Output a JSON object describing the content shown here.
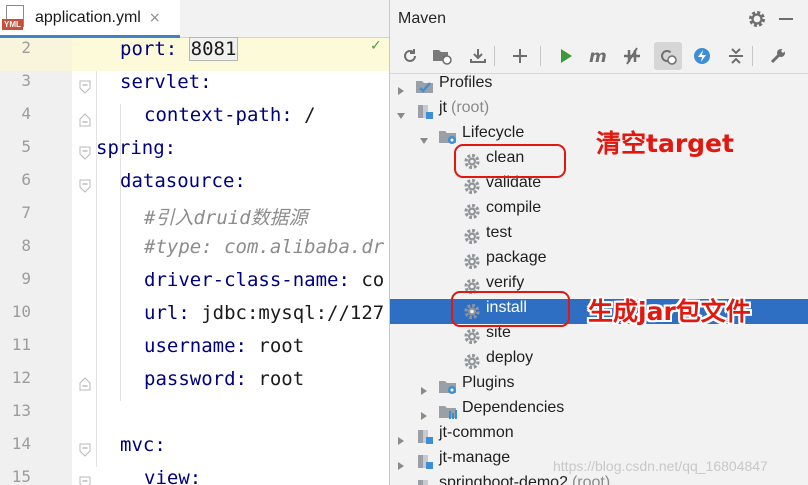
{
  "editor": {
    "tab_title": "application.yml",
    "tab_icon_label": "YML",
    "tab_close": "×",
    "lines": [
      {
        "num": "2",
        "key": "port",
        "sep": ": ",
        "val": "8081",
        "current": true
      },
      {
        "num": "3",
        "key": "servlet",
        "sep": ":",
        "val": ""
      },
      {
        "num": "4",
        "key": "context-path",
        "sep": ": ",
        "val": "/"
      },
      {
        "num": "5",
        "key": "spring",
        "sep": ":",
        "val": ""
      },
      {
        "num": "6",
        "key": "datasource",
        "sep": ":",
        "val": ""
      },
      {
        "num": "7",
        "comment": "#引入druid数据源"
      },
      {
        "num": "8",
        "comment": "#type: com.alibaba.dr"
      },
      {
        "num": "9",
        "key": "driver-class-name",
        "sep": ": ",
        "val": "co"
      },
      {
        "num": "10",
        "key": "url",
        "sep": ": ",
        "val": "jdbc:mysql://127"
      },
      {
        "num": "11",
        "key": "username",
        "sep": ": ",
        "val": "root"
      },
      {
        "num": "12",
        "key": "password",
        "sep": ": ",
        "val": "root"
      },
      {
        "num": "13"
      },
      {
        "num": "14",
        "key": "mvc",
        "sep": ":",
        "val": ""
      },
      {
        "num": "15",
        "key": "view",
        "sep": ":",
        "val": ""
      }
    ]
  },
  "maven": {
    "title": "Maven",
    "toolbar_icons": [
      "reload-icon",
      "generate-sources-icon",
      "download-icon",
      "add-icon",
      "run-icon",
      "execute-goal-icon",
      "toggle-offline-icon",
      "skip-tests-icon",
      "show-dependencies-icon",
      "collapse-all-icon",
      "settings-wrench-icon"
    ],
    "tree": [
      {
        "label": "Profiles",
        "muted": "",
        "icon": "profiles-icon",
        "arrow": "right",
        "level": 0
      },
      {
        "label": "jt",
        "muted": "(root)",
        "icon": "maven-module-icon",
        "arrow": "down",
        "level": 0
      },
      {
        "label": "Lifecycle",
        "muted": "",
        "icon": "lifecycle-folder-icon",
        "arrow": "down",
        "level": 1
      },
      {
        "label": "clean",
        "muted": "",
        "icon": "goal-gear-icon",
        "arrow": "",
        "level": 2
      },
      {
        "label": "validate",
        "muted": "",
        "icon": "goal-gear-icon",
        "arrow": "",
        "level": 2
      },
      {
        "label": "compile",
        "muted": "",
        "icon": "goal-gear-icon",
        "arrow": "",
        "level": 2
      },
      {
        "label": "test",
        "muted": "",
        "icon": "goal-gear-icon",
        "arrow": "",
        "level": 2
      },
      {
        "label": "package",
        "muted": "",
        "icon": "goal-gear-icon",
        "arrow": "",
        "level": 2
      },
      {
        "label": "verify",
        "muted": "",
        "icon": "goal-gear-icon",
        "arrow": "",
        "level": 2
      },
      {
        "label": "install",
        "muted": "",
        "icon": "goal-gear-icon",
        "arrow": "",
        "level": 2,
        "selected": true
      },
      {
        "label": "site",
        "muted": "",
        "icon": "goal-gear-icon",
        "arrow": "",
        "level": 2
      },
      {
        "label": "deploy",
        "muted": "",
        "icon": "goal-gear-icon",
        "arrow": "",
        "level": 2
      },
      {
        "label": "Plugins",
        "muted": "",
        "icon": "plugins-folder-icon",
        "arrow": "right",
        "level": 1
      },
      {
        "label": "Dependencies",
        "muted": "",
        "icon": "dependencies-folder-icon",
        "arrow": "right",
        "level": 1
      },
      {
        "label": "jt-common",
        "muted": "",
        "icon": "maven-module-icon",
        "arrow": "right",
        "level": 0
      },
      {
        "label": "jt-manage",
        "muted": "",
        "icon": "maven-module-icon",
        "arrow": "right",
        "level": 0
      },
      {
        "label": "springboot-demo2",
        "muted": "(root)",
        "icon": "maven-module-icon",
        "arrow": "right",
        "level": 0
      }
    ]
  },
  "annotations": {
    "clean_note": "清空target",
    "install_note": "生成jar包文件"
  },
  "watermark": "https://blog.csdn.net/qq_16804847",
  "colors": {
    "selection": "#2f6fc3",
    "annotation": "#e0180f",
    "yaml_key": "#000080",
    "comment": "#8c8c8c"
  }
}
